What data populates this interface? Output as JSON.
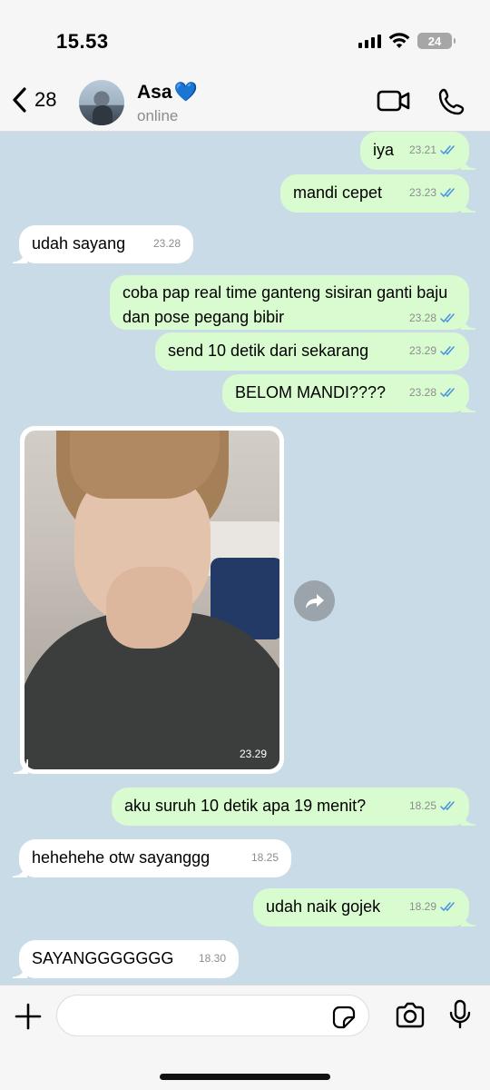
{
  "status_bar": {
    "time": "15.53",
    "battery": "24"
  },
  "header": {
    "back_count": "28",
    "contact_name": "Asa",
    "contact_emoji": "💙",
    "contact_status": "online"
  },
  "messages": [
    {
      "dir": "out",
      "text": "iya",
      "time": "23.21",
      "read": true
    },
    {
      "dir": "out",
      "text": "mandi cepet",
      "time": "23.23",
      "read": true
    },
    {
      "dir": "in",
      "text": "udah sayang",
      "time": "23.28"
    },
    {
      "dir": "out",
      "text": "coba pap real time ganteng sisiran ganti baju dan pose pegang bibir",
      "time": "23.28",
      "read": true
    },
    {
      "dir": "out",
      "text": "send 10 detik dari sekarang",
      "time": "23.29",
      "read": true
    },
    {
      "dir": "out",
      "text": "BELOM MANDI????",
      "time": "23.28",
      "read": true
    },
    {
      "dir": "in",
      "type": "photo",
      "time": "23.29"
    },
    {
      "dir": "out",
      "text": "aku suruh 10 detik apa 19 menit?",
      "time": "18.25",
      "read": true
    },
    {
      "dir": "in",
      "text": "hehehehe otw sayanggg",
      "time": "18.25"
    },
    {
      "dir": "out",
      "text": "udah naik gojek",
      "time": "18.29",
      "read": true
    },
    {
      "dir": "in",
      "text": "SAYANGGGGGGG",
      "time": "18.30"
    }
  ],
  "input": {
    "placeholder": ""
  },
  "icons": {
    "back": "chevron-left-icon",
    "video": "video-call-icon",
    "call": "phone-icon",
    "add": "plus-icon",
    "sticker": "sticker-icon",
    "camera": "camera-icon",
    "mic": "microphone-icon",
    "forward": "forward-icon",
    "read": "double-check-icon"
  },
  "colors": {
    "chat_bg": "#cadbe8",
    "outgoing": "#d9fbd0",
    "incoming": "#ffffff",
    "read_tick": "#4a90e2"
  }
}
